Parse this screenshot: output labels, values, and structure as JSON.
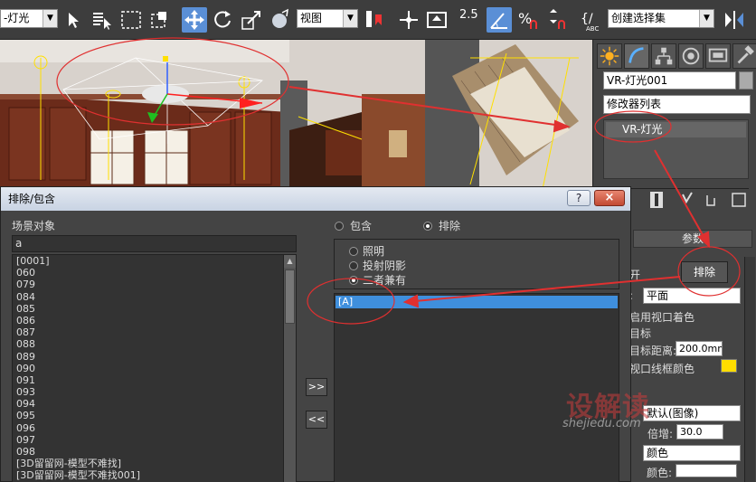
{
  "toolbar": {
    "selection_filter": "-灯光",
    "reference_coord": "视图",
    "snap_angle": "2.5",
    "selection_set": "创建选择集",
    "abc_label": "ABC"
  },
  "viewport": {
    "light_gizmo": "light-icon"
  },
  "command_panel": {
    "object_name": "VR-灯光001",
    "modifier_list": "修改器列表",
    "stack_item": "VR-灯光",
    "params_rollout": "参数",
    "exclude_button": "排除",
    "type_value": "平面",
    "viewport_shading_label": "启用视口着色",
    "target_label": "目标",
    "target_distance_label": "目标距离:",
    "target_distance_value": "200.0mm",
    "wire_color_label": "视口线框颜色",
    "wire_color": "#ffdd00",
    "mode_value": "默认(图像)",
    "multiplier_label": "倍增:",
    "multiplier_value": "30.0",
    "color_mode_value": "颜色",
    "color_label": "颜色:",
    "light_color": "#ffffff"
  },
  "dialog": {
    "title": "排除/包含",
    "help_button": "?",
    "close_button": "×",
    "scene_objects_label": "场景对象",
    "search_value": "a",
    "scene_objects": [
      "[0001]",
      "060",
      "079",
      "084",
      "085",
      "086",
      "087",
      "088",
      "089",
      "090",
      "091",
      "093",
      "094",
      "095",
      "096",
      "097",
      "098",
      "[3D留留网-模型不难找]",
      "[3D留留网-模型不难找001]"
    ],
    "move_right": ">>",
    "move_left": "<<",
    "include_option": "包含",
    "exclude_option": "排除",
    "illumination_option": "照明",
    "shadow_option": "投射阴影",
    "both_option": "二者兼有",
    "excluded_items": [
      "[A]"
    ]
  },
  "watermark": {
    "main": "设解读",
    "sub": "shejiedu.com"
  },
  "colors": {
    "accent": "#5a8fd6",
    "selection": "#3f8fdd",
    "annotation": "#e03030",
    "light_gizmo": "#ffffff"
  }
}
